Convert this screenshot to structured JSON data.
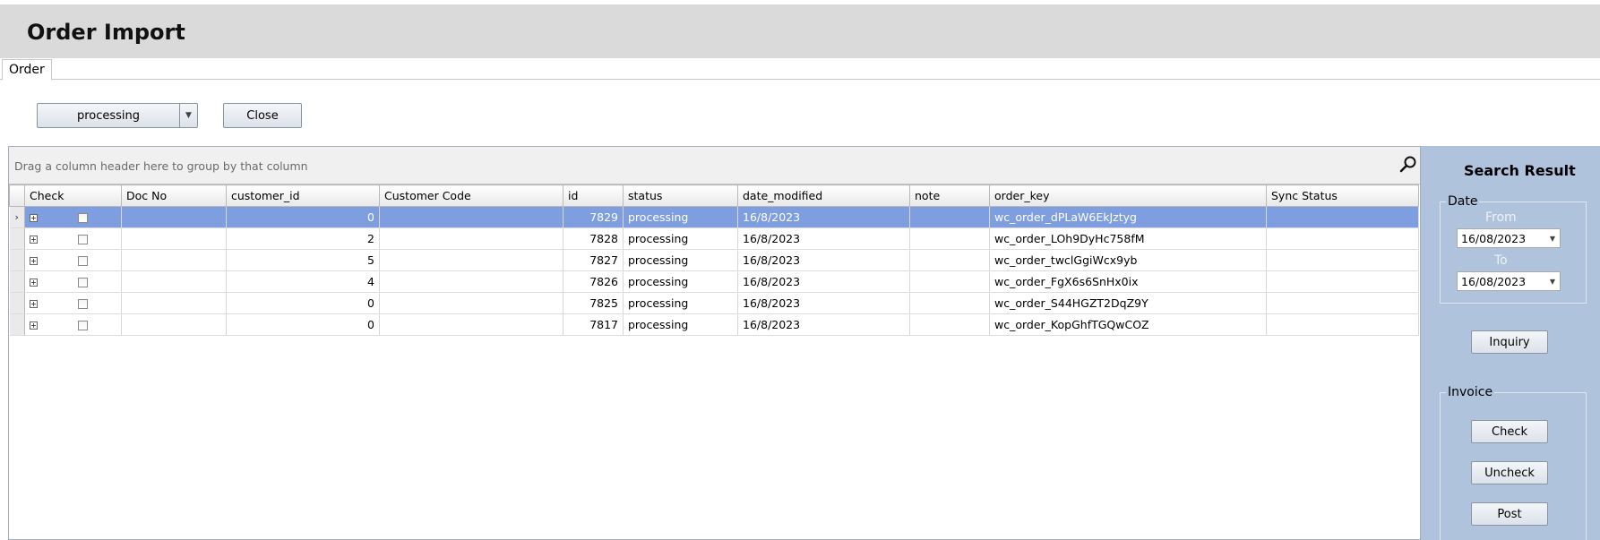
{
  "header": {
    "title": "Order Import"
  },
  "tabs": [
    {
      "label": "Order"
    }
  ],
  "toolbar": {
    "status_filter": "processing",
    "close_label": "Close"
  },
  "grid": {
    "group_hint": "Drag a column header here to group by that column",
    "columns": [
      "Check",
      "Doc No",
      "customer_id",
      "Customer Code",
      "id",
      "status",
      "date_modified",
      "note",
      "order_key",
      "Sync Status"
    ],
    "rows": [
      {
        "doc_no": "",
        "customer_id": "0",
        "customer_code": "",
        "id": "7829",
        "status": "processing",
        "date_modified": "16/8/2023",
        "note": "",
        "order_key": "wc_order_dPLaW6EkJztyg",
        "sync_status": ""
      },
      {
        "doc_no": "",
        "customer_id": "2",
        "customer_code": "",
        "id": "7828",
        "status": "processing",
        "date_modified": "16/8/2023",
        "note": "",
        "order_key": "wc_order_LOh9DyHc758fM",
        "sync_status": ""
      },
      {
        "doc_no": "",
        "customer_id": "5",
        "customer_code": "",
        "id": "7827",
        "status": "processing",
        "date_modified": "16/8/2023",
        "note": "",
        "order_key": "wc_order_twclGgiWcx9yb",
        "sync_status": ""
      },
      {
        "doc_no": "",
        "customer_id": "4",
        "customer_code": "",
        "id": "7826",
        "status": "processing",
        "date_modified": "16/8/2023",
        "note": "",
        "order_key": "wc_order_FgX6s6SnHx0ix",
        "sync_status": ""
      },
      {
        "doc_no": "",
        "customer_id": "0",
        "customer_code": "",
        "id": "7825",
        "status": "processing",
        "date_modified": "16/8/2023",
        "note": "",
        "order_key": "wc_order_S44HGZT2DqZ9Y",
        "sync_status": ""
      },
      {
        "doc_no": "",
        "customer_id": "0",
        "customer_code": "",
        "id": "7817",
        "status": "processing",
        "date_modified": "16/8/2023",
        "note": "",
        "order_key": "wc_order_KopGhfTGQwCOZ",
        "sync_status": ""
      }
    ],
    "selected_row": 0
  },
  "side_panel": {
    "title": "Search Result",
    "date_group": "Date",
    "from_label": "From",
    "from_value": "16/08/2023",
    "to_label": "To",
    "to_value": "16/08/2023",
    "inquiry_label": "Inquiry",
    "invoice_group": "Invoice",
    "check_label": "Check",
    "uncheck_label": "Uncheck",
    "post_label": "Post"
  },
  "colors": {
    "selection": "#7e9ee0",
    "side_panel": "#b0c3dd",
    "title_bar": "#dadada"
  }
}
